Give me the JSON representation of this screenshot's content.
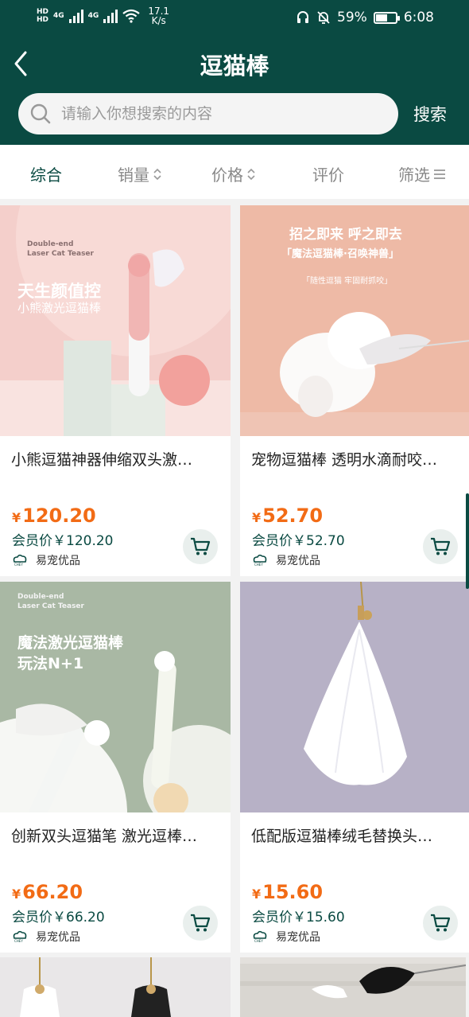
{
  "status_bar": {
    "hd1": "HD",
    "hd2": "HD",
    "net_type1": "4G",
    "net_type2": "4G",
    "speed_value": "17.1",
    "speed_unit": "K/s",
    "battery_percent": "59%",
    "battery_level": 0.59,
    "time": "6:08"
  },
  "header": {
    "title": "逗猫棒",
    "search_placeholder": "请输入你想搜索的内容",
    "search_button": "搜索"
  },
  "sort_bar": {
    "tabs": [
      {
        "label": "综合",
        "active": true
      },
      {
        "label": "销量"
      },
      {
        "label": "价格"
      },
      {
        "label": "评价"
      },
      {
        "label": "筛选"
      }
    ]
  },
  "products": [
    {
      "name": "小熊逗猫神器伸缩双头激…",
      "price_symbol": "¥",
      "price": "120.20",
      "member_price": "会员价￥120.20",
      "shop": "易宠优品",
      "image_text": {
        "en_line1": "Double-end",
        "en_line2": "Laser Cat Teaser",
        "headline": "天生颜值控",
        "sub": "小熊激光逗猫棒"
      }
    },
    {
      "name": "宠物逗猫棒 透明水滴耐咬…",
      "price_symbol": "¥",
      "price": "52.70",
      "member_price": "会员价￥52.70",
      "shop": "易宠优品",
      "image_text": {
        "headline": "招之即来 呼之即去",
        "sub": "「魔法逗猫棒·召唤神兽」",
        "sub2": "「随性逗猫 牢固耐抓咬」"
      }
    },
    {
      "name": "创新双头逗猫笔 激光逗棒…",
      "price_symbol": "¥",
      "price": "66.20",
      "member_price": "会员价￥66.20",
      "shop": "易宠优品",
      "image_text": {
        "en_line1": "Double-end",
        "en_line2": "Laser Cat Teaser",
        "headline": "魔法激光逗猫棒",
        "sub": "玩法N+1"
      }
    },
    {
      "name": "低配版逗猫棒绒毛替换头…",
      "price_symbol": "¥",
      "price": "15.60",
      "member_price": "会员价￥15.60",
      "shop": "易宠优品"
    }
  ],
  "colors": {
    "header_bg": "#0a4a42",
    "price": "#f26b15",
    "accent": "#0a4a42"
  },
  "icons": [
    "back-arrow-icon",
    "search-icon",
    "sort-arrows-icon",
    "filter-icon",
    "cart-icon",
    "shop-logo-icon",
    "wifi-icon",
    "headset-icon",
    "mute-bell-icon",
    "battery-icon"
  ]
}
